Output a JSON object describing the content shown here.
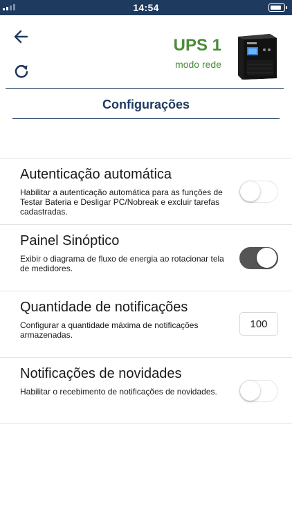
{
  "status_bar": {
    "time": "14:54"
  },
  "header": {
    "ups_name": "UPS 1",
    "ups_mode": "modo rede",
    "back_icon": "arrow-left-icon",
    "refresh_icon": "refresh-icon"
  },
  "page": {
    "title": "Configurações"
  },
  "settings": [
    {
      "title": "Autenticação automática",
      "description": "Habilitar a autenticação automática para as funções de Testar Bateria e Desligar PC/Nobreak e excluir tarefas cadastradas.",
      "control": "toggle",
      "enabled": false
    },
    {
      "title": "Painel Sinóptico",
      "description": "Exibir o diagrama de fluxo de energia ao rotacionar tela de medidores.",
      "control": "toggle",
      "enabled": true
    },
    {
      "title": "Quantidade de notificações",
      "description": "Configurar a quantidade máxima de notificações armazenadas.",
      "control": "number",
      "value": "100"
    },
    {
      "title": "Notificações de novidades",
      "description": "Habilitar o recebimento de notificações de novidades.",
      "control": "toggle",
      "enabled": false
    }
  ],
  "colors": {
    "primary": "#1f3a5f",
    "status_ok": "#4a8c3a",
    "toggle_on": "#555555"
  }
}
